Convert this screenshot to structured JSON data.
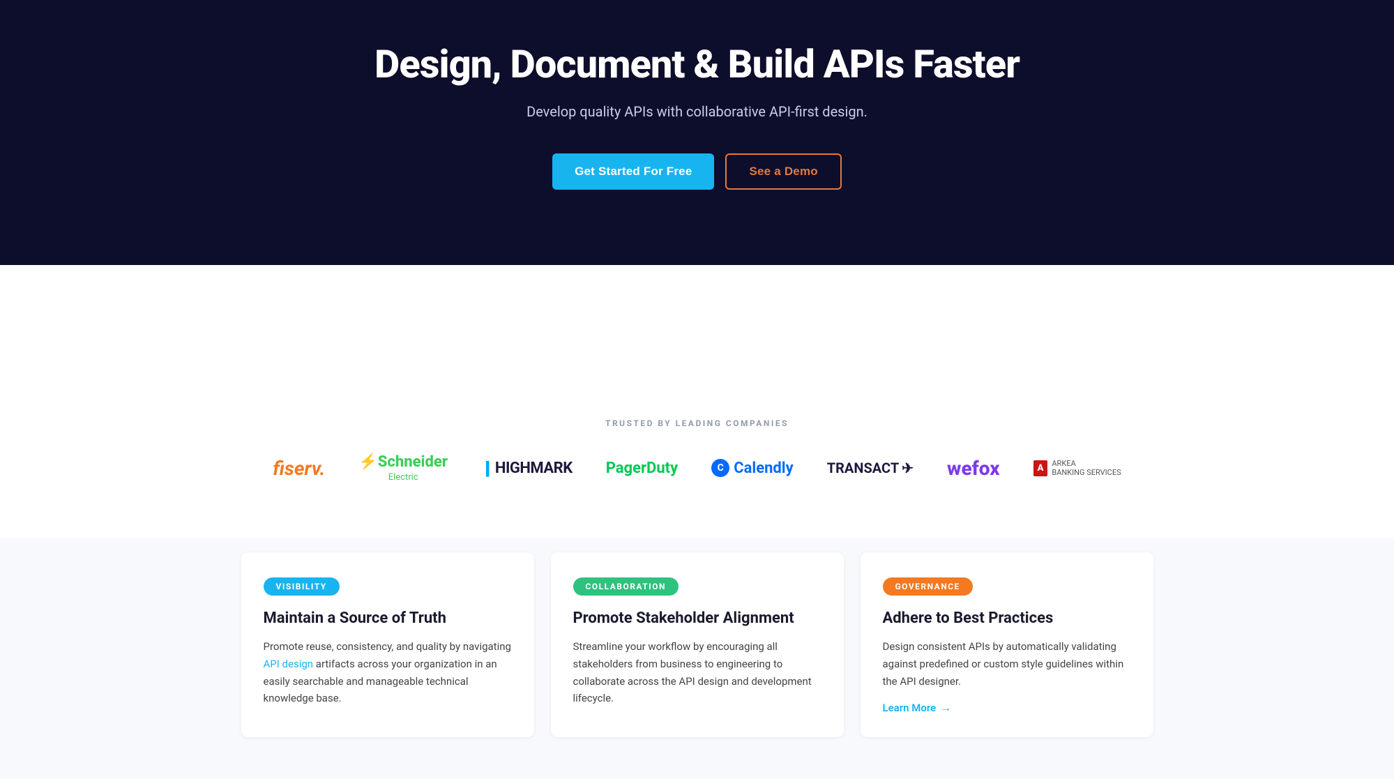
{
  "hero": {
    "title": "Design, Document & Build APIs Faster",
    "subtitle": "Develop quality APIs with collaborative API-first design.",
    "btn_primary": "Get Started For Free",
    "btn_outline": "See a Demo"
  },
  "trusted": {
    "label": "TRUSTED BY LEADING COMPANIES",
    "logos": [
      {
        "name": "fiserv",
        "text": "fiserv."
      },
      {
        "name": "schneider-electric",
        "text": "Schneider Electric"
      },
      {
        "name": "highmark",
        "text": "HIGHMARK"
      },
      {
        "name": "pagerduty",
        "text": "PagerDuty"
      },
      {
        "name": "calendly",
        "text": "Calendly"
      },
      {
        "name": "transact",
        "text": "TRANSACT"
      },
      {
        "name": "wefox",
        "text": "wefox"
      },
      {
        "name": "arkea",
        "text": "ARKEA BANKING SERVICES"
      }
    ]
  },
  "cards": [
    {
      "badge": "VISIBILITY",
      "badge_class": "badge-visibility",
      "title": "Maintain a Source of Truth",
      "description_before": "Promote reuse, consistency, and quality by navigating ",
      "link_text": "API design",
      "description_after": " artifacts across your organization in an easily searchable and manageable technical knowledge base.",
      "learn_more": null
    },
    {
      "badge": "COLLABORATION",
      "badge_class": "badge-collaboration",
      "title": "Promote Stakeholder Alignment",
      "description_before": "Streamline your workflow by encouraging all stakeholders from business to engineering to collaborate across the API design and development lifecycle.",
      "link_text": null,
      "description_after": null,
      "learn_more": null
    },
    {
      "badge": "GOVERNANCE",
      "badge_class": "badge-governance",
      "title": "Adhere to Best Practices",
      "description_before": "Design consistent APIs by automatically validating against predefined or custom style guidelines within the API designer.",
      "link_text": null,
      "description_after": null,
      "learn_more": "Learn More"
    }
  ],
  "icons": {
    "arrow_right": "→"
  }
}
